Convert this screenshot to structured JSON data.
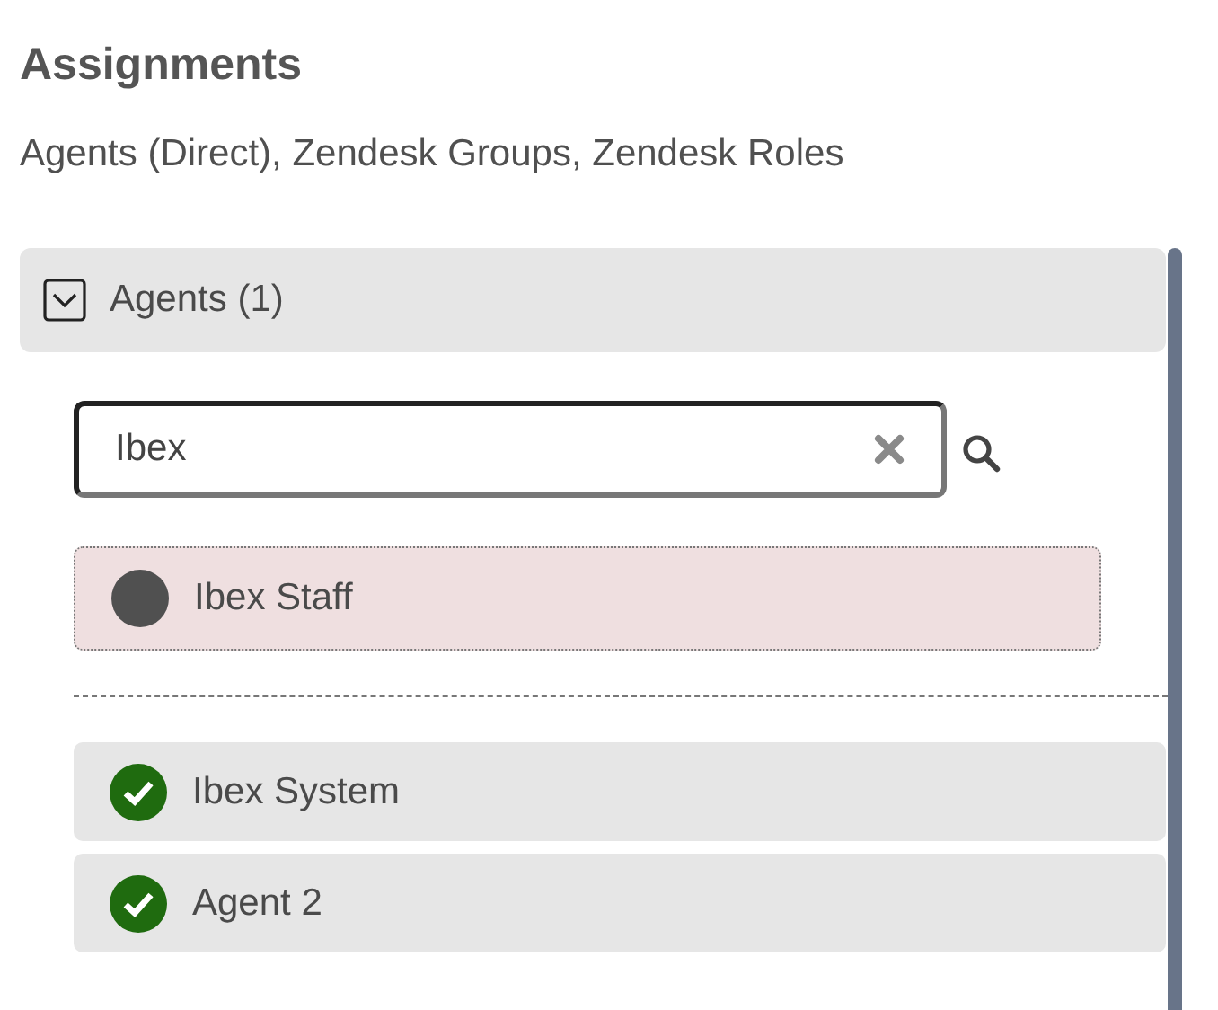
{
  "title": "Assignments",
  "subtitle": "Agents (Direct), Zendesk Groups, Zendesk Roles",
  "section": {
    "label": "Agents (1)",
    "expanded": true
  },
  "search": {
    "value": "Ibex"
  },
  "results": [
    {
      "name": "Ibex Staff",
      "checked": false
    }
  ],
  "assigned": [
    {
      "name": "Ibex System",
      "checked": true
    },
    {
      "name": "Agent 2",
      "checked": true
    }
  ]
}
